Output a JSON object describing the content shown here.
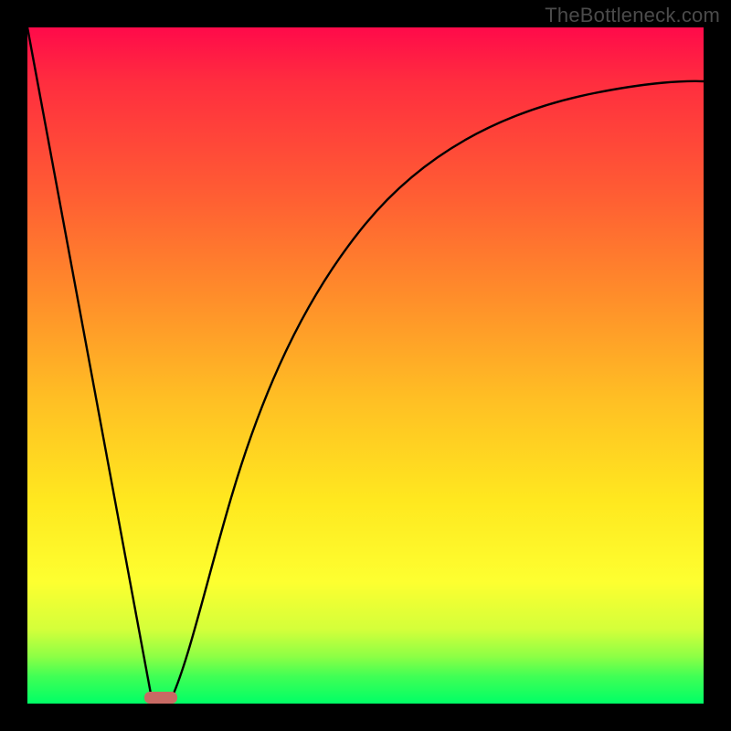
{
  "watermark": "TheBottleneck.com",
  "colors": {
    "frame": "#000000",
    "gradient_top": "#ff0a4a",
    "gradient_bottom": "#00ff66",
    "curve": "#000000",
    "marker": "#c86a64"
  },
  "chart_data": {
    "type": "line",
    "title": "",
    "xlabel": "",
    "ylabel": "",
    "xlim": [
      0,
      100
    ],
    "ylim": [
      0,
      100
    ],
    "grid": false,
    "legend": false,
    "series": [
      {
        "name": "left-leg",
        "x": [
          0,
          18.5
        ],
        "values": [
          100,
          0
        ]
      },
      {
        "name": "right-leg",
        "x": [
          21,
          25,
          30,
          35,
          40,
          45,
          50,
          55,
          60,
          65,
          70,
          75,
          80,
          85,
          90,
          95,
          100
        ],
        "values": [
          0,
          14,
          30,
          42,
          52,
          60,
          67,
          72,
          76.5,
          80,
          83,
          85.5,
          87.5,
          89,
          90.3,
          91.3,
          92
        ]
      }
    ],
    "marker": {
      "x_start": 17.5,
      "x_end": 22,
      "y": 0
    }
  }
}
